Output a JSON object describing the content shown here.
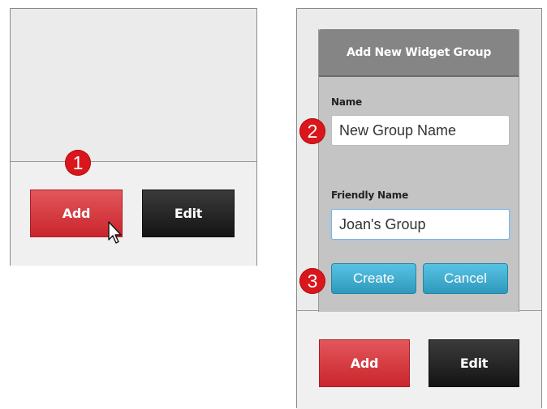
{
  "left_panel": {
    "marker": "1",
    "add_label": "Add",
    "edit_label": "Edit"
  },
  "right_panel": {
    "dialog": {
      "title": "Add New Widget Group",
      "name_label": "Name",
      "name_value": "New Group Name",
      "friendly_label": "Friendly Name",
      "friendly_value": "Joan's Group",
      "create_label": "Create",
      "cancel_label": "Cancel"
    },
    "marker_2": "2",
    "marker_3": "3",
    "add_label": "Add",
    "edit_label": "Edit"
  },
  "colors": {
    "add_button": "#d23a40",
    "edit_button": "#262626",
    "dialog_button": "#3fafd2",
    "step_marker": "#d9161c"
  },
  "icons": [
    "mouse-pointer-icon"
  ]
}
